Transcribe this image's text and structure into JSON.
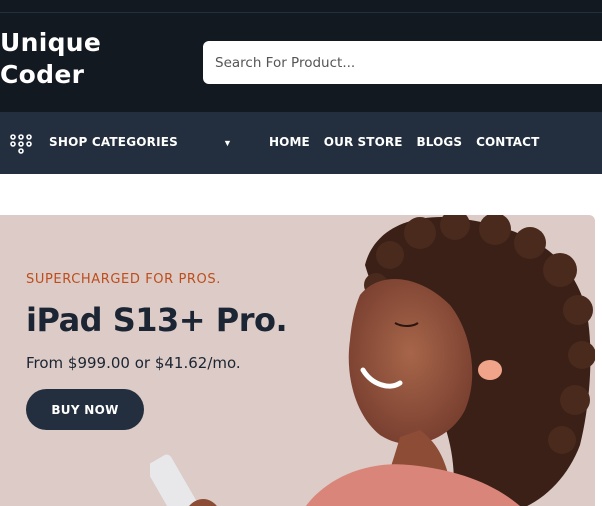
{
  "brand": {
    "line1": "Unique",
    "line2": "Coder"
  },
  "search": {
    "placeholder": "Search For Product..."
  },
  "nav": {
    "categories_label": "SHOP CATEGORIES",
    "links": [
      "HOME",
      "OUR STORE",
      "BLOGS",
      "CONTACT"
    ]
  },
  "hero": {
    "tagline": "SUPERCHARGED FOR PROS.",
    "title": "iPad S13+ Pro.",
    "price": "From $999.00 or $41.62/mo.",
    "cta": "BUY NOW"
  },
  "colors": {
    "header_bg": "#131921",
    "nav_bg": "#232f3e",
    "hero_bg": "#dccbc6",
    "accent": "#bd4d1c",
    "button_bg": "#232f3e"
  },
  "icons": {
    "categories": "grid-dots-icon",
    "dropdown": "caret-down-icon"
  }
}
